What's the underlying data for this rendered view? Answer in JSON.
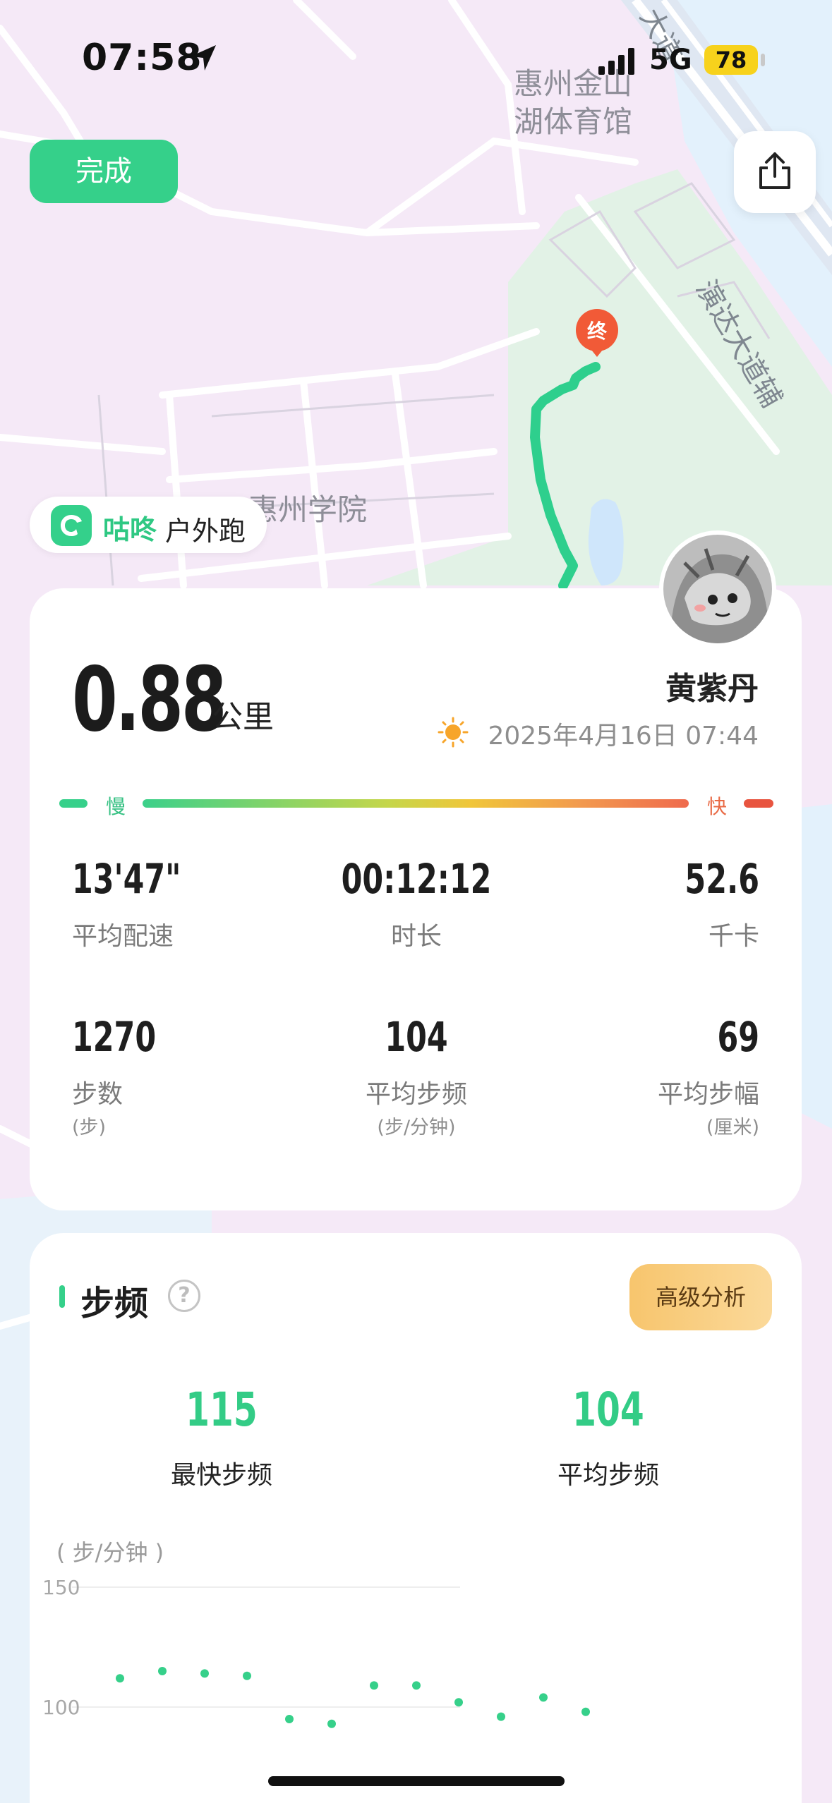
{
  "status_bar": {
    "time": "07:58",
    "network": "5G",
    "battery": "78"
  },
  "map": {
    "labels": {
      "stadium_line1": "惠州金山",
      "stadium_line2": "湖体育馆",
      "college": "惠州学院",
      "road_top": "大道",
      "road_right": "演达大道辅"
    },
    "end_marker": "终",
    "route_color": "#2ecf8d"
  },
  "toolbar": {
    "done_label": "完成",
    "share_icon": "share-icon"
  },
  "brand": {
    "name": "咕咚",
    "activity": "户外跑"
  },
  "summary": {
    "distance": "0.88",
    "distance_unit": "公里",
    "user_name": "黄紫丹",
    "date": "2025年4月16日 07:44",
    "speed_legend": {
      "slow": "慢",
      "fast": "快"
    }
  },
  "stats": [
    {
      "value": "13'47\"",
      "label": "平均配速",
      "unit": ""
    },
    {
      "value": "00:12:12",
      "label": "时长",
      "unit": ""
    },
    {
      "value": "52.6",
      "label": "千卡",
      "unit": ""
    },
    {
      "value": "1270",
      "label": "步数",
      "unit": "(步)"
    },
    {
      "value": "104",
      "label": "平均步频",
      "unit": "(步/分钟)"
    },
    {
      "value": "69",
      "label": "平均步幅",
      "unit": "(厘米)"
    }
  ],
  "cadence": {
    "title": "步频",
    "help": "?",
    "advanced_button": "高级分析",
    "max_value": "115",
    "max_label": "最快步频",
    "avg_value": "104",
    "avg_label": "平均步频",
    "unit_label": "( 步/分钟 )"
  },
  "chart_data": {
    "type": "scatter",
    "ylabel": "( 步/分钟 )",
    "ylim": [
      50,
      150
    ],
    "yticks": [
      "150",
      "100",
      "50"
    ],
    "x": [
      1,
      2,
      3,
      4,
      5,
      6,
      7,
      8,
      9,
      10,
      11,
      12
    ],
    "values": [
      112,
      115,
      114,
      113,
      95,
      93,
      109,
      109,
      102,
      96,
      104,
      98
    ],
    "color": "#36d08a",
    "grid": true
  }
}
